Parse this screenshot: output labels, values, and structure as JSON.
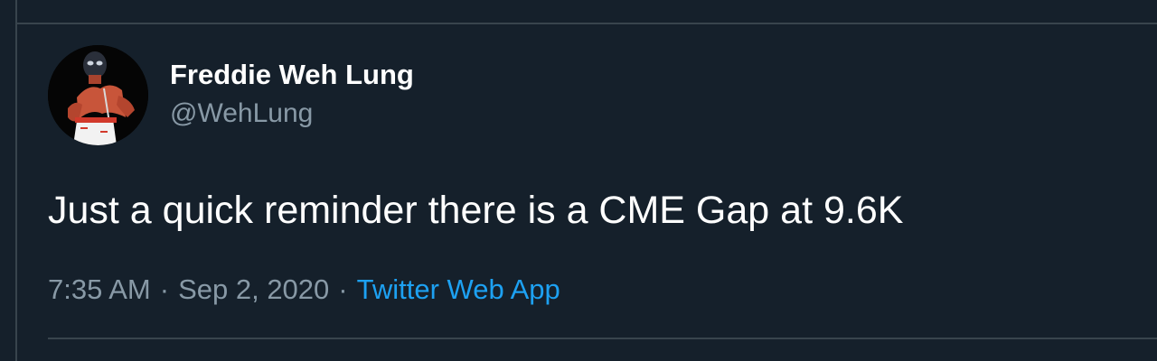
{
  "tweet": {
    "display_name": "Freddie Weh Lung",
    "handle": "@WehLung",
    "text": "Just a quick reminder there is a CME Gap at 9.6K",
    "time": "7:35 AM",
    "separator": "·",
    "date": "Sep 2, 2020",
    "source": "Twitter Web App"
  },
  "colors": {
    "background": "#15202b",
    "text": "#ffffff",
    "muted": "#8899a6",
    "link": "#1da1f2",
    "divider": "#38444d"
  }
}
